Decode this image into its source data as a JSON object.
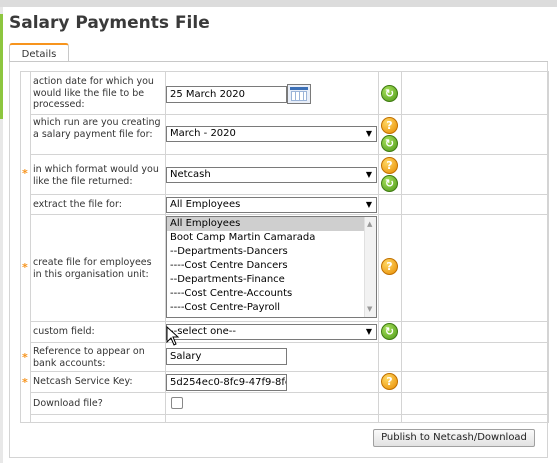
{
  "page": {
    "title": "Salary Payments File"
  },
  "tabs": [
    {
      "label": "Details",
      "active": true
    }
  ],
  "fields": {
    "action_date": {
      "label": "action date for which you would like the file to be processed:",
      "value": "25 March     2020"
    },
    "run": {
      "label": "which run are you creating a salary payment file for:",
      "value": "March - 2020"
    },
    "format": {
      "label": "in which format would you like the file returned:",
      "value": "Netcash",
      "required": true
    },
    "extract": {
      "label": "extract the file for:",
      "value": "All Employees"
    },
    "org_unit": {
      "label": "create file for employees in this organisation unit:",
      "required": true,
      "options": [
        "All Employees",
        "Boot Camp Martin Camarada",
        "--Departments-Dancers",
        "----Cost Centre Dancers",
        "--Departments-Finance",
        "----Cost Centre-Accounts",
        "----Cost Centre-Payroll"
      ],
      "selected": "All Employees"
    },
    "custom_field": {
      "label": "custom field:",
      "value": "--select one--"
    },
    "reference": {
      "label": "Reference to appear on bank accounts:",
      "value": "Salary",
      "required": true
    },
    "service_key": {
      "label": "Netcash Service Key:",
      "value": "5d254ec0-8fc9-47f9-8fc",
      "required": true
    },
    "download": {
      "label": "Download file?",
      "checked": false
    }
  },
  "actions": {
    "publish_label": "Publish to Netcash/Download"
  },
  "symbols": {
    "required": "*",
    "refresh": "↻",
    "help": "?",
    "caret": "▼",
    "up": "▲",
    "down": "▼"
  },
  "colors": {
    "accent": "#f7941d",
    "refresh": "#5aa41f",
    "help": "#f0a000",
    "selected_option": "#cfcfcf"
  }
}
